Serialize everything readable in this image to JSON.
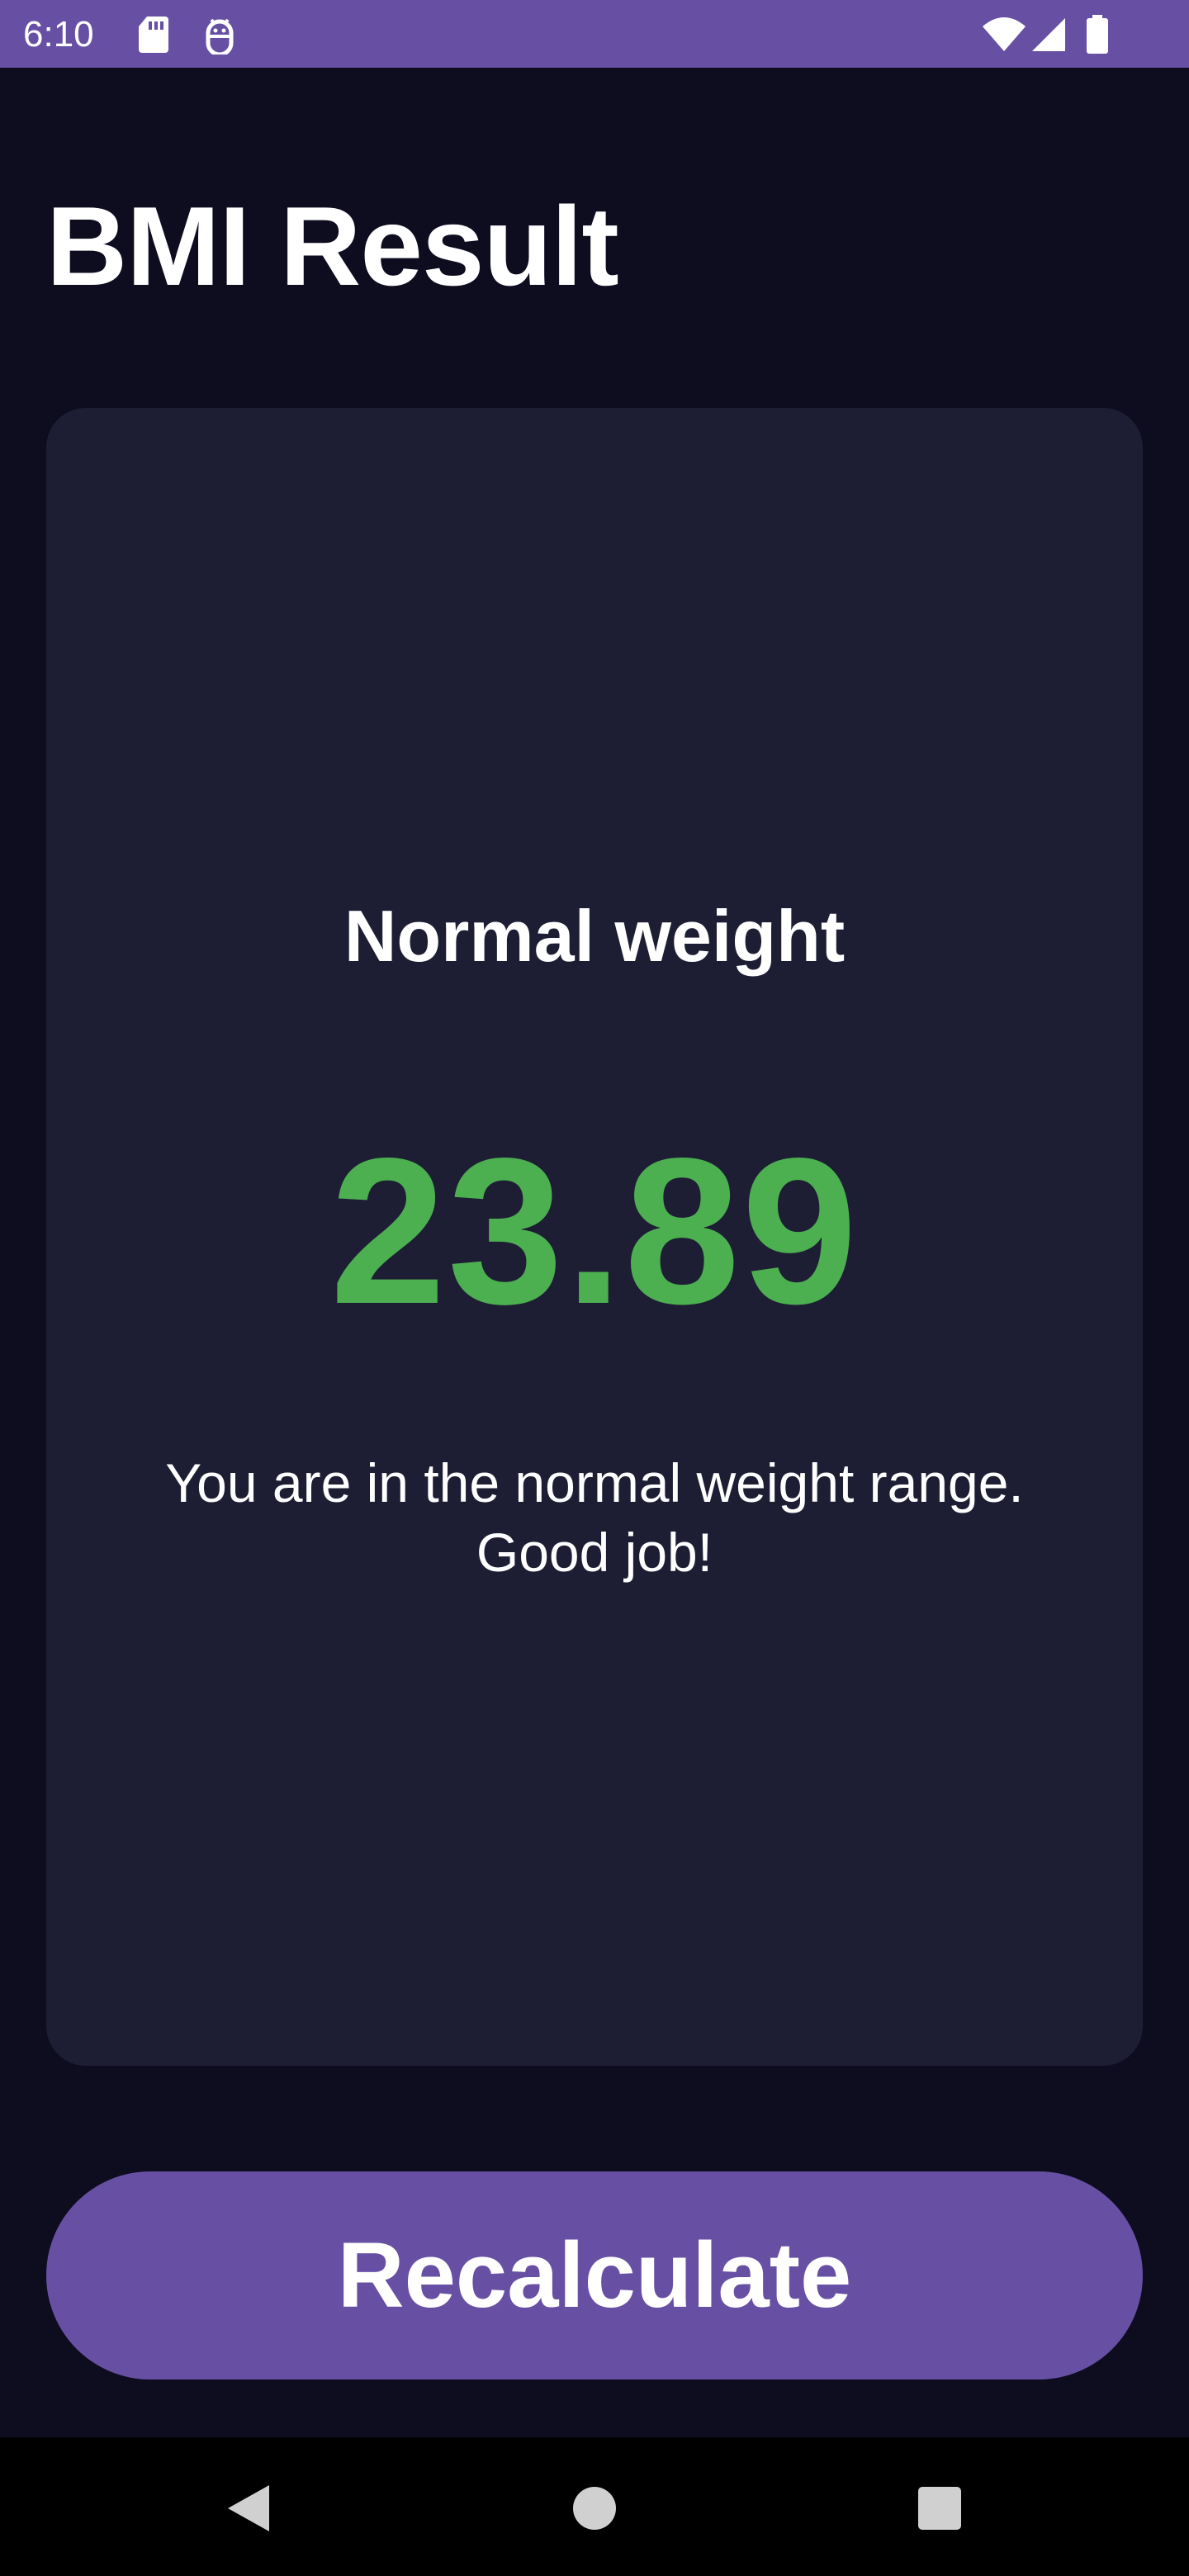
{
  "status_bar": {
    "time": "6:10",
    "icons": [
      "sd-card-icon",
      "android-debug-icon",
      "wifi-icon",
      "signal-icon",
      "battery-icon"
    ],
    "background": "#6750a4"
  },
  "header": {
    "title": "BMI Result"
  },
  "result": {
    "category": "Normal weight",
    "bmi_value": "23.89",
    "value_color": "#4caf50",
    "message_line1": "You are in the normal weight range.",
    "message_line2": "Good job!"
  },
  "actions": {
    "recalculate_label": "Recalculate",
    "button_color": "#6750a4"
  },
  "nav_bar": {
    "buttons": [
      "back-icon",
      "home-icon",
      "recents-icon"
    ]
  },
  "colors": {
    "background": "#0e0c1f",
    "card": "#1d1e33"
  }
}
